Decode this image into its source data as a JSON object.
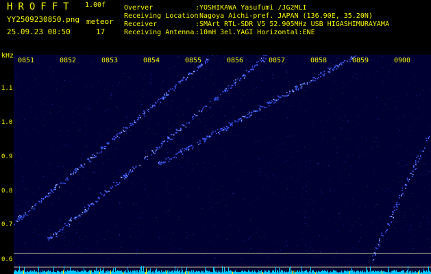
{
  "header": {
    "brand": "HROFFT",
    "version": "1.00f",
    "filename": "YY2509230850.png",
    "datetime": "25.09.23 08:50",
    "meteor_label": "meteor",
    "meteor_count": "17",
    "info": [
      {
        "key": "Overver",
        "value": ":YOSHIKAWA Yasufumi /JG2MLI"
      },
      {
        "key": "Receiving Location",
        "value": ":Nagoya Aichi-pref. JAPAN (136.90E, 35.20N)"
      },
      {
        "key": "Receiver",
        "value": ":SMArt RTL-SDR V5 52.905MHz USB HIGASHIMURAYAMA"
      },
      {
        "key": "Receiving Antenna",
        "value": ":10mH 3el.YAGI Horizontal:ENE"
      }
    ]
  },
  "plot": {
    "yunit": "kHz",
    "ylabels": [
      "1.1",
      "1.0",
      "0.9",
      "0.8",
      "0.7",
      "0.6"
    ],
    "xlabels": [
      "0851",
      "0852",
      "0853",
      "0854",
      "0855",
      "0856",
      "0857",
      "0858",
      "0859",
      "0900"
    ],
    "colors": {
      "background": "#000033",
      "trace": "#3a5cff",
      "label": "#f5f500",
      "hline": "#c8c8a0",
      "baseline": "#00c8ff"
    }
  }
}
